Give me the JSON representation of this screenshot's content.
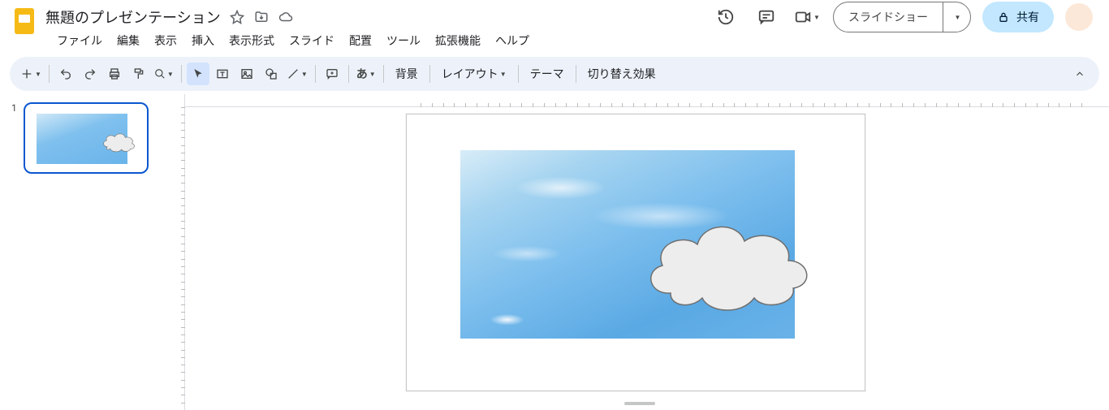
{
  "header": {
    "title": "無題のプレゼンテーション",
    "slideshow_label": "スライドショー",
    "share_label": "共有"
  },
  "menu": {
    "items": [
      "ファイル",
      "編集",
      "表示",
      "挿入",
      "表示形式",
      "スライド",
      "配置",
      "ツール",
      "拡張機能",
      "ヘルプ"
    ]
  },
  "toolbar": {
    "bold_glyph": "あ",
    "background_label": "背景",
    "layout_label": "レイアウト",
    "theme_label": "テーマ",
    "transition_label": "切り替え効果"
  },
  "filmstrip": {
    "slides": [
      {
        "number": "1"
      }
    ]
  }
}
